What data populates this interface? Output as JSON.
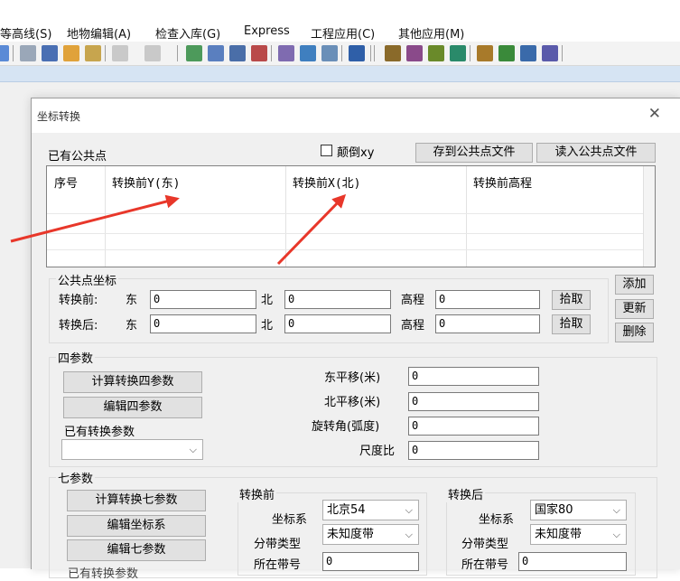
{
  "menubar": {
    "items": [
      "等高线(S)",
      "地物编辑(A)",
      "检查入库(G)",
      "Express",
      "工程应用(C)",
      "其他应用(M)"
    ]
  },
  "dialog": {
    "title": "坐标转换",
    "close_glyph": "✕",
    "common_points_label": "已有公共点",
    "flip_xy_label": "颠倒xy",
    "flip_xy_checked": false,
    "save_button": "存到公共点文件",
    "load_button": "读入公共点文件",
    "table": {
      "columns": [
        "序号",
        "转换前Y(东)",
        "转换前X(北)",
        "转换前高程"
      ],
      "rows": []
    },
    "common_point_coords": {
      "title": "公共点坐标",
      "before_label": "转换前:",
      "after_label": "转换后:",
      "east_label": "东",
      "north_label": "北",
      "elev_label": "高程",
      "before": {
        "east": "0",
        "north": "0",
        "elev": "0"
      },
      "after": {
        "east": "0",
        "north": "0",
        "elev": "0"
      },
      "pick_button": "拾取"
    },
    "side_buttons": {
      "add": "添加",
      "update": "更新",
      "delete": "删除"
    },
    "four_param": {
      "title": "四参数",
      "calc_button": "计算转换四参数",
      "edit_button": "编辑四参数",
      "existing_label": "已有转换参数",
      "existing_value": "",
      "east_shift_label": "东平移(米)",
      "north_shift_label": "北平移(米)",
      "rotation_label": "旋转角(弧度)",
      "scale_label": "尺度比",
      "east_shift": "0",
      "north_shift": "0",
      "rotation": "0",
      "scale": "0"
    },
    "seven_param": {
      "title": "七参数",
      "calc_button": "计算转换七参数",
      "edit_coord_button": "编辑坐标系",
      "edit_seven_button": "编辑七参数",
      "existing_label_partial": "已有转换参数",
      "before": {
        "title": "转换前",
        "coord_sys_label": "坐标系",
        "coord_sys_value": "北京54",
        "zone_type_label": "分带类型",
        "zone_type_value": "未知度带",
        "zone_no_label": "所在带号",
        "zone_no_value": "0"
      },
      "after": {
        "title": "转换后",
        "coord_sys_label": "坐标系",
        "coord_sys_value": "国家80",
        "zone_type_label": "分带类型",
        "zone_type_value": "未知度带",
        "zone_no_label": "所在带号",
        "zone_no_value": "0"
      }
    }
  },
  "colors": {
    "arrow": "#e8372a",
    "toolbar_bg": "#f3f3f3",
    "dialog_bg": "#f0f0f0",
    "accent_strip": "#d6e4f3"
  }
}
